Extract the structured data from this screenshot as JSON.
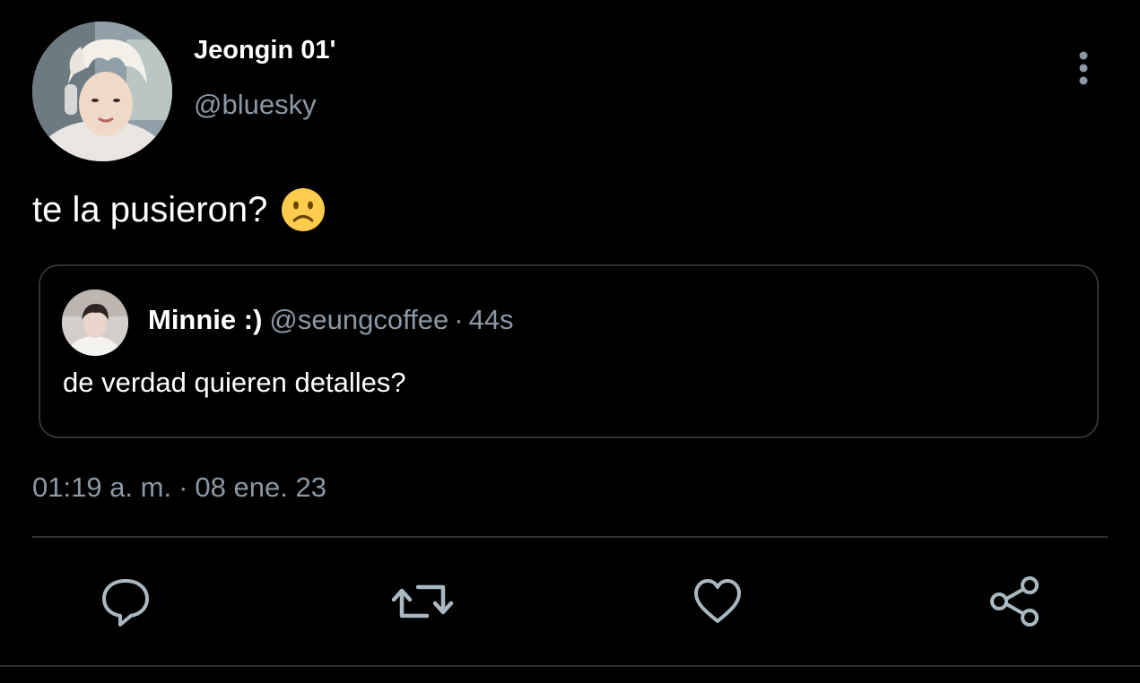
{
  "author": {
    "display_name": "Jeongin 01'",
    "handle": "@bluesky"
  },
  "post": {
    "text": "te la pusieron?",
    "emoji": "slightly-frowning-face"
  },
  "quoted_post": {
    "display_name": "Minnie :)",
    "handle": "@seungcoffee",
    "separator": "·",
    "age": "44s",
    "text": "de verdad quieren detalles?"
  },
  "timestamp": {
    "time": "01:19 a. m.",
    "separator": "·",
    "date": "08 ene. 23"
  },
  "actions": [
    {
      "name": "reply",
      "icon": "speech-bubble-icon"
    },
    {
      "name": "repost",
      "icon": "repost-arrows-icon"
    },
    {
      "name": "like",
      "icon": "heart-icon"
    },
    {
      "name": "share",
      "icon": "share-nodes-icon"
    }
  ],
  "colors": {
    "background": "#000000",
    "text_primary": "#ffffff",
    "text_secondary": "#8b98a5",
    "border": "#2f3336",
    "icon": "#aab8c2"
  }
}
